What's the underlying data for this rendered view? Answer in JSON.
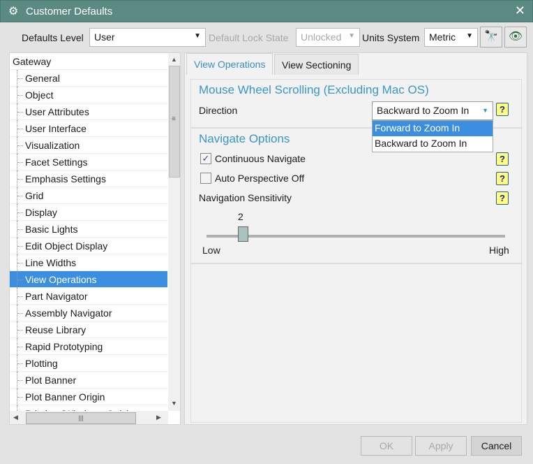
{
  "window": {
    "title": "Customer Defaults",
    "icon": "gear-icon",
    "close": "✕"
  },
  "toolbar": {
    "defaults_level_label": "Defaults Level",
    "defaults_level_value": "User",
    "lock_state_label": "Default Lock State",
    "lock_state_value": "Unlocked",
    "units_label": "Units System",
    "units_value": "Metric",
    "find_icon": "binoculars-icon",
    "view_icon": "eye-arrow-icon"
  },
  "tree": {
    "root": "Gateway",
    "items": [
      "General",
      "Object",
      "User Attributes",
      "User Interface",
      "Visualization",
      "Facet Settings",
      "Emphasis Settings",
      "Grid",
      "Display",
      "Basic Lights",
      "Edit Object Display",
      "Line Widths",
      "View Operations",
      "Part Navigator",
      "Assembly Navigator",
      "Reuse Library",
      "Rapid Prototyping",
      "Plotting",
      "Plot Banner",
      "Plot Banner Origin",
      "Printing (Windows Only)"
    ],
    "selected": "View Operations"
  },
  "tabs": [
    "View Operations",
    "View Sectioning"
  ],
  "mouse_wheel": {
    "title": "Mouse Wheel Scrolling (Excluding Mac OS)",
    "direction_label": "Direction",
    "direction_value": "Backward to Zoom In",
    "options": [
      "Forward to Zoom In",
      "Backward to Zoom In"
    ],
    "highlighted": "Forward to Zoom In"
  },
  "navigate": {
    "title": "Navigate Options",
    "continuous_label": "Continuous Navigate",
    "continuous_checked": true,
    "auto_persp_label": "Auto Perspective Off",
    "auto_persp_checked": false,
    "sensitivity_label": "Navigation Sensitivity",
    "sensitivity_value": "2",
    "low": "Low",
    "high": "High"
  },
  "help": "?",
  "buttons": {
    "ok": "OK",
    "apply": "Apply",
    "cancel": "Cancel"
  },
  "colors": {
    "titlebar": "#5b8a82",
    "accent": "#3a96c8",
    "selection": "#3c8fe0"
  }
}
